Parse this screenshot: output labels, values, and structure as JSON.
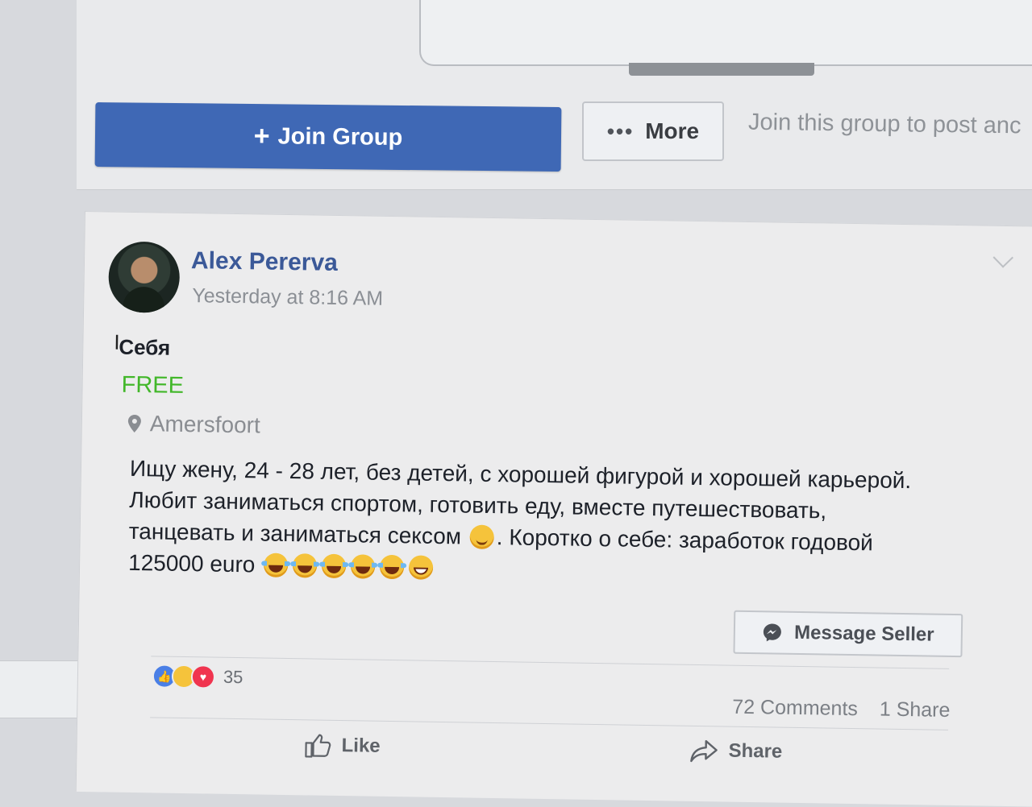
{
  "group_header": {
    "join_label": "Join Group",
    "more_label": "More",
    "join_hint": "Join this group to post anc"
  },
  "post": {
    "author": "Alex Pererva",
    "timestamp": "Yesterday at 8:16 AM",
    "item_title": "Себя",
    "price": "FREE",
    "location": "Amersfoort",
    "description_1": "Ищу жену, 24 - 28 лет, без детей, с хорошей фигурой и хорошей карьерой. Любит заниматься спортом, готовить еду, вместе путешествовать, танцевать и заниматься сексом",
    "description_2": ". Коротко о себе: заработок годовой 125000 euro",
    "message_seller_label": "Message Seller",
    "reactions_count": "35",
    "comments": "72 Comments",
    "shares": "1 Share",
    "like_label": "Like",
    "share_label": "Share"
  },
  "icons": {
    "plus": "plus-icon",
    "dots": "more-dots-icon",
    "pin": "location-pin-icon",
    "messenger": "messenger-icon",
    "search": "search-icon",
    "like": "thumbs-up-icon",
    "share": "share-arrow-icon"
  },
  "colors": {
    "primary": "#3f68b5",
    "author_link": "#3b5998",
    "price_green": "#42b72a",
    "muted_text": "#8b8f95"
  }
}
